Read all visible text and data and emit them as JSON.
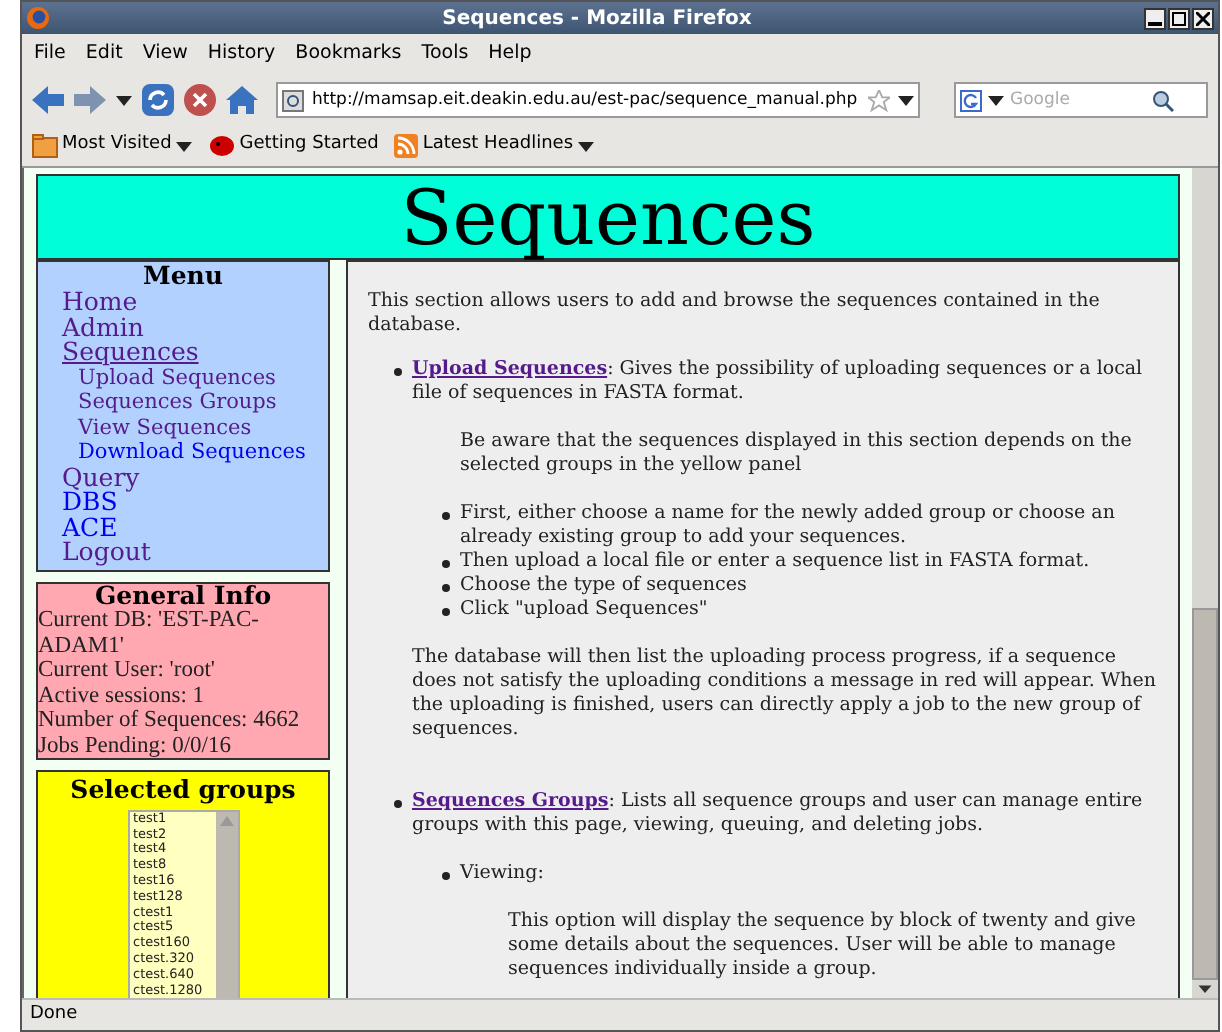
{
  "window": {
    "title": "Sequences - Mozilla Firefox"
  },
  "menu_bar": [
    "File",
    "Edit",
    "View",
    "History",
    "Bookmarks",
    "Tools",
    "Help"
  ],
  "address": {
    "value": "http://mamsap.eit.deakin.edu.au/est-pac/sequence_manual.php"
  },
  "search": {
    "placeholder": "Google"
  },
  "bookmarks": [
    {
      "label": "Most Visited",
      "kind": "folder",
      "dropdown": true
    },
    {
      "label": "Getting Started",
      "kind": "page",
      "dropdown": false
    },
    {
      "label": "Latest Headlines",
      "kind": "feed",
      "dropdown": true
    }
  ],
  "page": {
    "heading": "Sequences",
    "menu": {
      "title": "Menu",
      "items": [
        {
          "label": "Home",
          "visited": true,
          "current": false
        },
        {
          "label": "Admin",
          "visited": true,
          "current": false
        },
        {
          "label": "Sequences",
          "visited": true,
          "current": true,
          "children": [
            {
              "label": "Upload Sequences",
              "visited": true,
              "current": false
            },
            {
              "label": "Sequences Groups",
              "visited": true,
              "current": false
            },
            {
              "label": "View Sequences",
              "visited": true,
              "current": false
            },
            {
              "label": "Download Sequences",
              "visited": false,
              "current": false
            }
          ]
        },
        {
          "label": "Query",
          "visited": true,
          "current": false
        },
        {
          "label": "DBS",
          "visited": false,
          "current": false
        },
        {
          "label": "ACE",
          "visited": false,
          "current": false
        },
        {
          "label": "Logout",
          "visited": true,
          "current": false
        }
      ]
    },
    "general_info": {
      "title": "General Info",
      "lines": [
        "Current DB: 'EST-PAC-ADAM1'",
        "Current User: 'root'",
        "Active sessions: 1",
        "Number of Sequences: 4662",
        "Jobs Pending: 0/0/16"
      ]
    },
    "selected_groups": {
      "title": "Selected groups",
      "items": [
        "test1",
        "test2",
        "test4",
        "test8",
        "test16",
        "test128",
        "ctest1",
        "ctest5",
        "ctest160",
        "ctest.320",
        "ctest.640",
        "ctest.1280"
      ]
    },
    "content": {
      "intro": "This section allows users to add and browse the sequences contained in the database.",
      "sections": [
        {
          "link": "Upload Sequences",
          "text": ": Gives the possibility of uploading sequences or a local file of sequences in FASTA format.",
          "note": "Be aware that the sequences displayed in this section depends on the selected groups in the yellow panel",
          "steps": [
            "First, either choose a name for the newly added group or choose an already existing group to add your sequences.",
            "Then upload a local file or enter a sequence list in FASTA format.",
            "Choose the type of sequences",
            "Click \"upload Sequences\""
          ],
          "after": "The database will then list the uploading process progress, if a sequence does not satisfy the uploading conditions a message in red will appear. When the uploading is finished, users can directly apply a job to the new group of sequences."
        },
        {
          "link": "Sequences Groups",
          "text": ": Lists all sequence groups and user can manage entire groups with this page, viewing, queuing, and deleting jobs.",
          "subs": [
            {
              "label": "Viewing:",
              "text": "This option will display the sequence by block of twenty and give some details about the sequences. User will be able to manage sequences individually inside a group."
            }
          ]
        }
      ]
    }
  },
  "status_bar": {
    "text": "Done"
  }
}
